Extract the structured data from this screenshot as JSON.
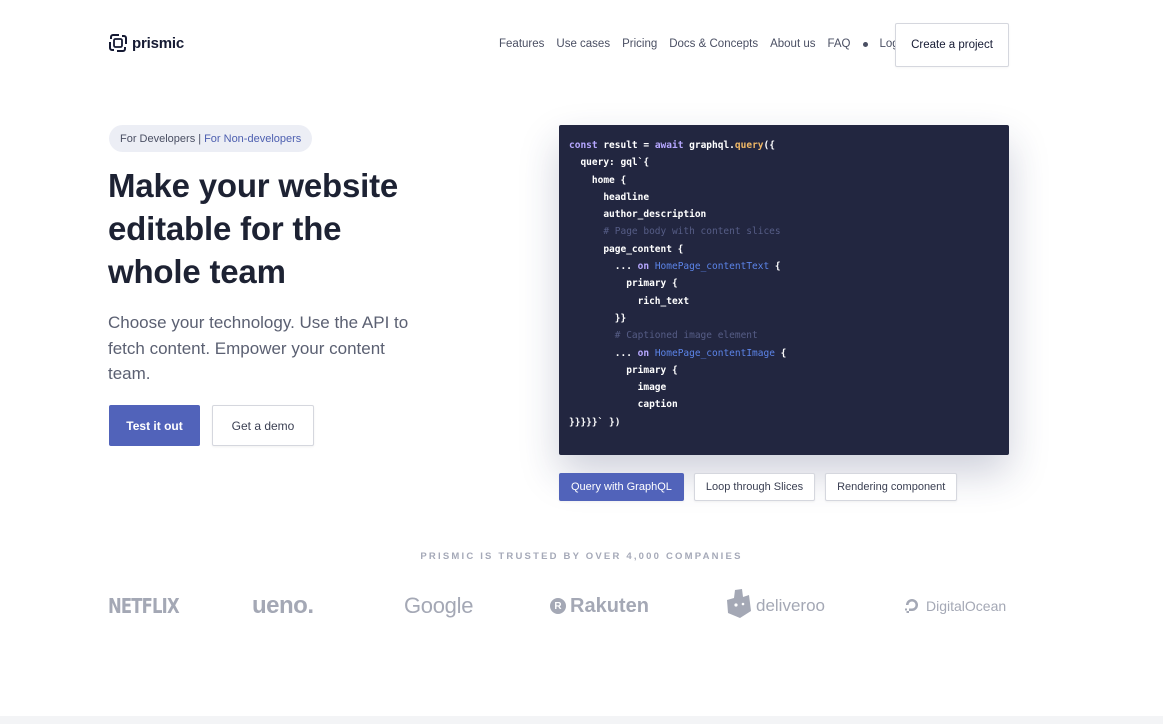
{
  "header": {
    "logo_text": "prismic",
    "nav": [
      "Features",
      "Use cases",
      "Pricing",
      "Docs & Concepts",
      "About us",
      "FAQ"
    ],
    "login": "Login",
    "cta": "Create a project"
  },
  "hero": {
    "audience": {
      "developers": "For Developers",
      "separator": "|",
      "non_developers": "For Non-developers"
    },
    "title": "Make your website editable for the whole team",
    "subtitle": "Choose your technology. Use the API to fetch content. Empower your content team.",
    "primary_button": "Test it out",
    "secondary_button": "Get a demo"
  },
  "code": {
    "lines": [
      [
        {
          "t": "const ",
          "c": "kw"
        },
        {
          "t": "result = ",
          "c": ""
        },
        {
          "t": "await ",
          "c": "kw"
        },
        {
          "t": "graphql.",
          "c": ""
        },
        {
          "t": "query",
          "c": "fn"
        },
        {
          "t": "({",
          "c": ""
        }
      ],
      [
        {
          "t": "  query: gql`{",
          "c": ""
        }
      ],
      [
        {
          "t": "    home {",
          "c": ""
        }
      ],
      [
        {
          "t": "      headline",
          "c": ""
        }
      ],
      [
        {
          "t": "      author_description",
          "c": ""
        }
      ],
      [
        {
          "t": "      # Page body with content slices",
          "c": "cm"
        }
      ],
      [
        {
          "t": "      page_content {",
          "c": ""
        }
      ],
      [
        {
          "t": "        ... ",
          "c": ""
        },
        {
          "t": "on ",
          "c": "kw"
        },
        {
          "t": "HomePage_contentText",
          "c": "ty"
        },
        {
          "t": " {",
          "c": ""
        }
      ],
      [
        {
          "t": "          primary {",
          "c": ""
        }
      ],
      [
        {
          "t": "            rich_text",
          "c": ""
        }
      ],
      [
        {
          "t": "        }}",
          "c": ""
        }
      ],
      [
        {
          "t": "        # Captioned image element",
          "c": "cm"
        }
      ],
      [
        {
          "t": "        ... ",
          "c": ""
        },
        {
          "t": "on ",
          "c": "kw"
        },
        {
          "t": "HomePage_contentImage",
          "c": "ty"
        },
        {
          "t": " {",
          "c": ""
        }
      ],
      [
        {
          "t": "          primary {",
          "c": ""
        }
      ],
      [
        {
          "t": "            image",
          "c": ""
        }
      ],
      [
        {
          "t": "            caption",
          "c": ""
        }
      ],
      [
        {
          "t": "}}}}}` })",
          "c": ""
        }
      ]
    ],
    "tabs": [
      {
        "label": "Query with GraphQL",
        "active": true
      },
      {
        "label": "Loop through Slices",
        "active": false
      },
      {
        "label": "Rendering component",
        "active": false
      }
    ]
  },
  "trusted": {
    "heading": "PRISMIC IS TRUSTED BY OVER 4,000 COMPANIES",
    "brands": [
      "NETFLIX",
      "ueno.",
      "Google",
      "Rakuten",
      "deliveroo",
      "DigitalOcean"
    ]
  },
  "colors": {
    "accent": "#5163ba",
    "code_bg": "#222640",
    "logo_gray": "#a4a8b5"
  }
}
